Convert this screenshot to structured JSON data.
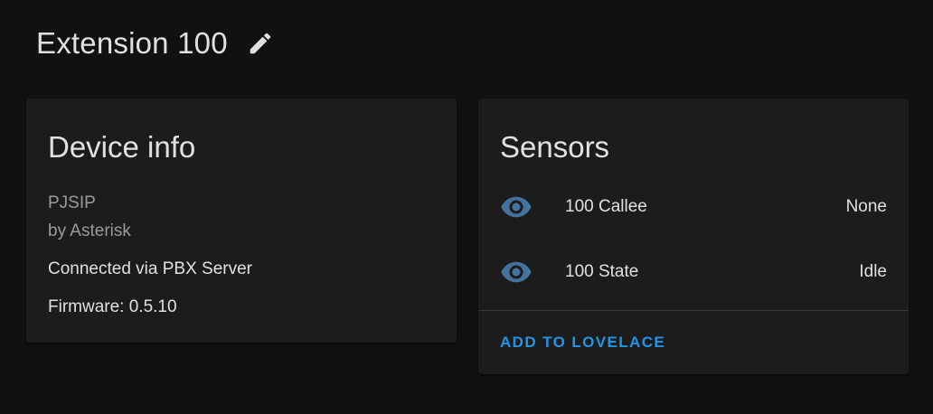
{
  "header": {
    "title": "Extension 100",
    "edit_icon": "pencil-icon"
  },
  "device_info": {
    "title": "Device info",
    "model": "PJSIP",
    "manufacturer": "by Asterisk",
    "connected_via": "Connected via PBX Server",
    "firmware": "Firmware: 0.5.10"
  },
  "sensors": {
    "title": "Sensors",
    "items": [
      {
        "icon": "eye-icon",
        "name": "100 Callee",
        "value": "None"
      },
      {
        "icon": "eye-icon",
        "name": "100 State",
        "value": "Idle"
      }
    ],
    "action_label": "ADD TO LOVELACE"
  },
  "colors": {
    "background": "#111111",
    "card": "#1c1c1c",
    "icon": "#44739e",
    "accent": "#2196e6",
    "text": "#e1e1e1",
    "muted_text": "#9b9b9b"
  }
}
